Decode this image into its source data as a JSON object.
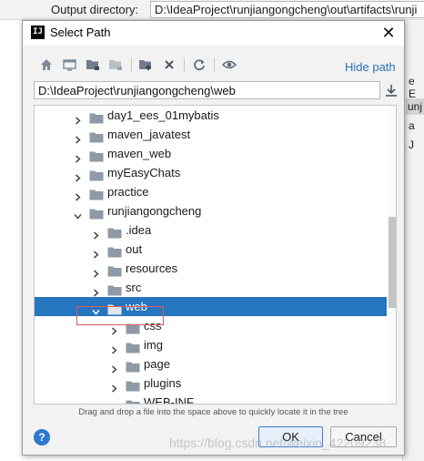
{
  "background": {
    "output_label": "Output directory:",
    "output_value": "D:\\IdeaProject\\runjiangongcheng\\out\\artifacts\\runji",
    "right_panel_text": "e E",
    "right_panel_selected": "unj",
    "right_panel_item_1": "a",
    "right_panel_item_2": "J"
  },
  "dialog": {
    "logo_text": "IJ",
    "title": "Select Path",
    "close_glyph": "✕",
    "hide_path_label": "Hide path",
    "path_value": "D:\\IdeaProject\\runjiangongcheng\\web",
    "toolbar_icons": [
      "home-icon",
      "desktop-icon",
      "project-icon",
      "module-icon",
      "new-folder-icon",
      "delete-icon",
      "refresh-icon",
      "show-hidden-icon"
    ],
    "tree": [
      {
        "label": "day1_ees_01mybatis",
        "level": 0,
        "expanded": false
      },
      {
        "label": "maven_javatest",
        "level": 0,
        "expanded": false
      },
      {
        "label": "maven_web",
        "level": 0,
        "expanded": false
      },
      {
        "label": "myEasyChats",
        "level": 0,
        "expanded": false
      },
      {
        "label": "practice",
        "level": 0,
        "expanded": false
      },
      {
        "label": "runjiangongcheng",
        "level": 0,
        "expanded": true
      },
      {
        "label": ".idea",
        "level": 1,
        "expanded": false
      },
      {
        "label": "out",
        "level": 1,
        "expanded": false
      },
      {
        "label": "resources",
        "level": 1,
        "expanded": false
      },
      {
        "label": "src",
        "level": 1,
        "expanded": false
      },
      {
        "label": "web",
        "level": 1,
        "expanded": true,
        "selected": true
      },
      {
        "label": "css",
        "level": 2,
        "expanded": false
      },
      {
        "label": "img",
        "level": 2,
        "expanded": false
      },
      {
        "label": "page",
        "level": 2,
        "expanded": false
      },
      {
        "label": "plugins",
        "level": 2,
        "expanded": false
      },
      {
        "label": "WEB-INF",
        "level": 2,
        "expanded": false
      }
    ],
    "hint": "Drag and drop a file into the space above to quickly locate it in the tree",
    "help_label": "?",
    "ok_label": "OK",
    "cancel_label": "Cancel"
  },
  "watermark": "https://blog.csdn.net/weixin_42209238",
  "colors": {
    "selection": "#2675bf",
    "link": "#2e6fb8",
    "folder": "#8e9aa5",
    "highlight_box": "#e05a5a"
  }
}
